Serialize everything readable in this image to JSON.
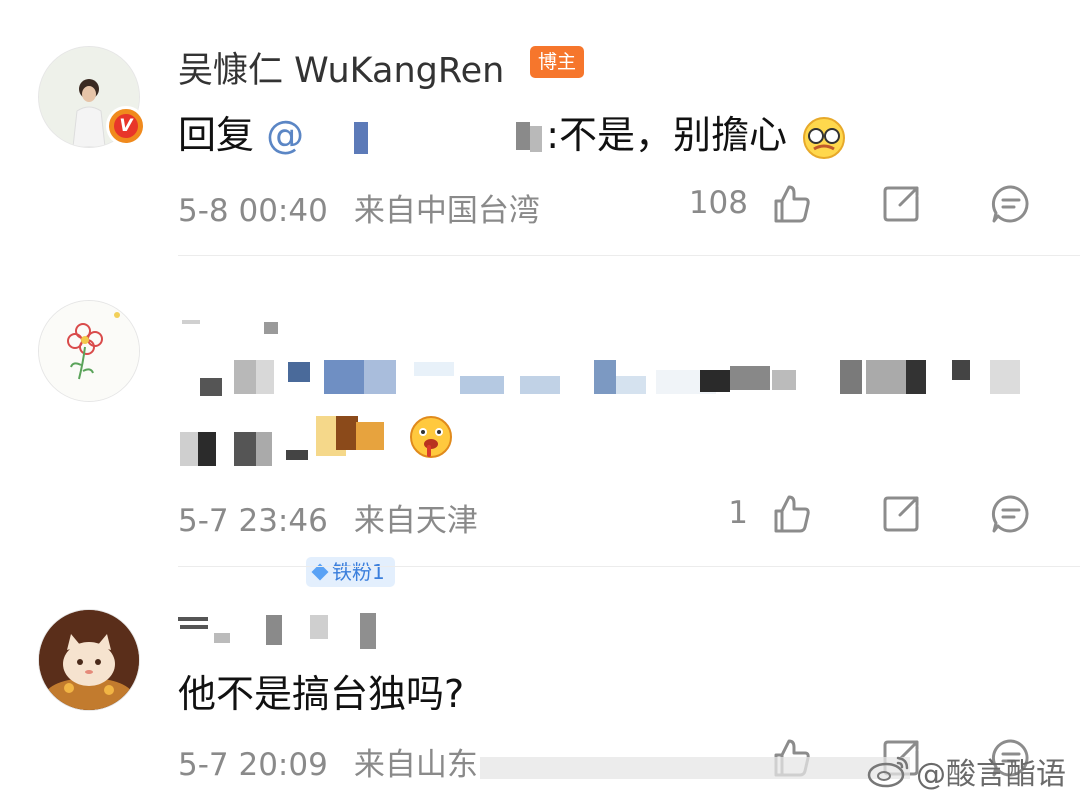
{
  "comments": [
    {
      "user_name": "吴慷仁 WuKangRen",
      "tag": "博主",
      "reply_prefix": "回复",
      "mention": "@",
      "text": ":不是，别擔心",
      "time": "5-8 00:40",
      "location": "来自中国台湾",
      "likes": "108",
      "verified": "V"
    },
    {
      "user_name": "",
      "tag": "铁粉1",
      "time": "5-7 23:46",
      "location": "来自天津",
      "likes": "1"
    },
    {
      "user_name": "",
      "text": "他不是搞台独吗?",
      "time": "5-7 20:09",
      "location": "来自山东",
      "likes": ""
    }
  ],
  "watermark": "@酸言酯语",
  "icons": [
    "like-icon",
    "share-icon",
    "comment-icon",
    "weibo-logo-icon"
  ],
  "colors": {
    "mention": "#5b86c5",
    "blogger_tag": "#f6762c",
    "fan_tag_bg": "#e3effd",
    "fan_tag_text": "#3b7fdc",
    "meta": "#8a8a8a"
  }
}
